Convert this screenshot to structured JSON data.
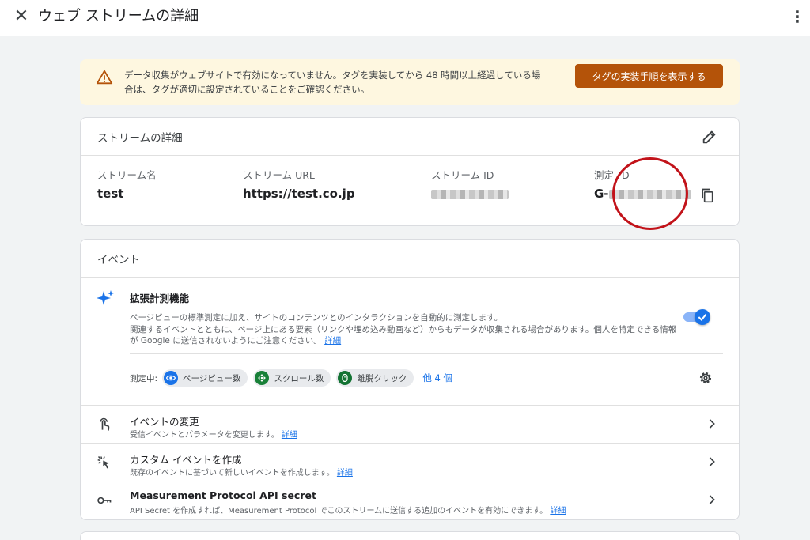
{
  "header": {
    "close_icon": "close-icon",
    "title": "ウェブ ストリームの詳細",
    "more_icon": "more-vert-icon"
  },
  "warning": {
    "icon": "warning-icon",
    "line1": "データ収集がウェブサイトで有効になっていません。タグを実装してから 48 時間以上経過している場",
    "line2": "合は、タグが適切に設定されていることをご確認ください。",
    "button": "タグの実装手順を表示する"
  },
  "stream": {
    "title": "ストリームの詳細",
    "edit_icon": "pencil-icon",
    "name_label": "ストリーム名",
    "name_value": "test",
    "url_label": "ストリーム URL",
    "url_value": "https://test.co.jp",
    "id_label": "ストリーム ID",
    "mid_label_a": "測定",
    "mid_label_b": "D",
    "mid_prefix": "G-",
    "copy_icon": "copy-icon"
  },
  "events": {
    "title": "イベント",
    "enhanced": {
      "icon": "sparkle-icon",
      "title": "拡張計測機能",
      "desc1": "ページビューの標準測定に加え、サイトのコンテンツとのインタラクションを自動的に測定します。",
      "desc2": "関連するイベントとともに、ページ上にある要素（リンクや埋め込み動画など）からもデータが収集される場合があります。個人を特定できる情報",
      "desc3": "が Google に送信されないようにご注意ください。",
      "desc_link": "詳細",
      "toggle_on": true,
      "measuring_label": "測定中:",
      "chips": [
        {
          "label": "ページビュー数",
          "icon": "eye-icon",
          "color": "#1a73e8"
        },
        {
          "label": "スクロール数",
          "icon": "crosshair-icon",
          "color": "#188038"
        },
        {
          "label": "離脱クリック",
          "icon": "mouse-icon",
          "color": "#137333"
        }
      ],
      "more": "他 4 個",
      "settings_icon": "gear-icon"
    },
    "rows": [
      {
        "icon": "touch-icon",
        "title": "イベントの変更",
        "sub": "受信イベントとパラメータを変更します。",
        "link": "詳細"
      },
      {
        "icon": "click-icon",
        "title": "カスタム イベントを作成",
        "sub": "既存のイベントに基づいて新しいイベントを作成します。",
        "link": "詳細"
      },
      {
        "icon": "key-icon",
        "title": "Measurement Protocol API secret",
        "sub": "API Secret を作成すれば、Measurement Protocol でこのストリームに送信する追加のイベントを有効にできます。",
        "link": "詳細"
      }
    ]
  },
  "colors": {
    "accent": "#1a73e8",
    "warning_button": "#b45309",
    "warning_bg": "#fef7e0",
    "annotation_circle": "#c2131a"
  }
}
